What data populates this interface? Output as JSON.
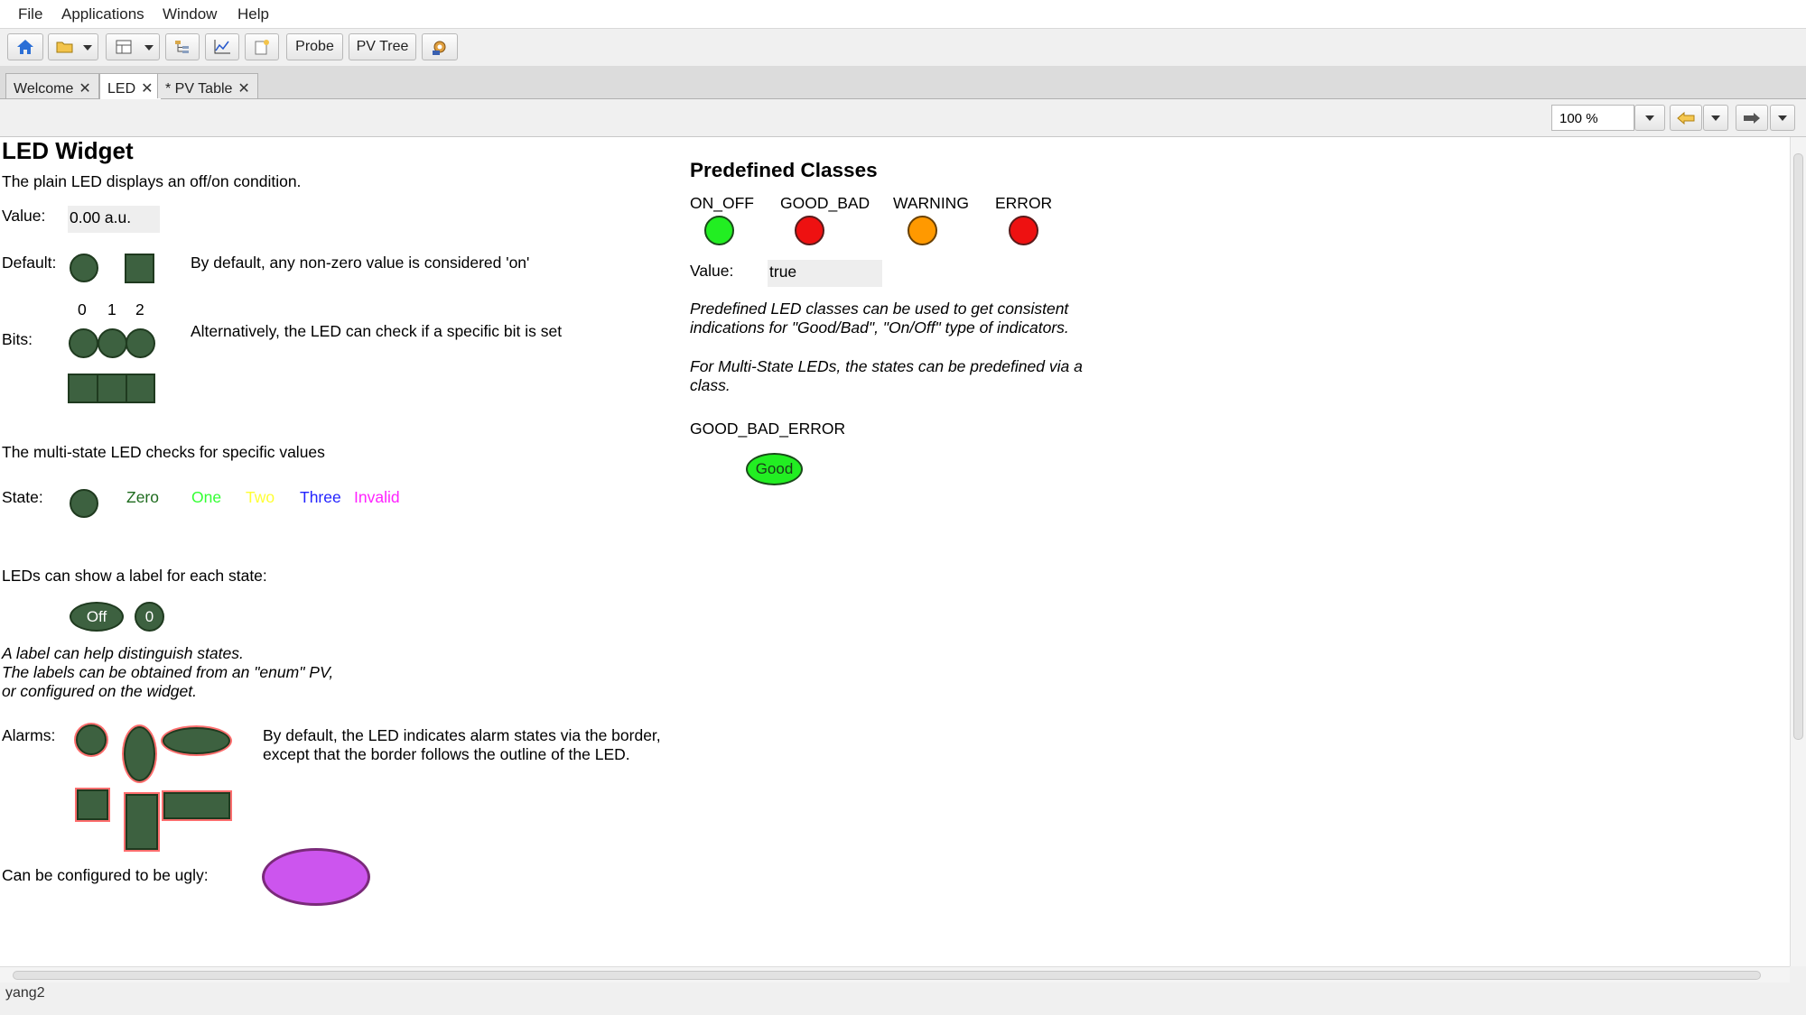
{
  "menu": [
    "File",
    "Applications",
    "Window",
    "Help"
  ],
  "toolbar": {
    "probe_label": "Probe",
    "pvtree_label": "PV Tree"
  },
  "tabs": [
    {
      "label": "Welcome",
      "close": "✕"
    },
    {
      "label": "LED",
      "close": "✕"
    },
    {
      "label": "* PV Table",
      "close": "✕"
    }
  ],
  "display_toolbar": {
    "zoom": "100 %"
  },
  "left": {
    "title": "LED Widget",
    "intro": "The plain LED displays an off/on condition.",
    "value_label": "Value:",
    "value_field": "0.00 a.u.",
    "default_label": "Default:",
    "default_desc": "By default, any non-zero value is considered 'on'",
    "bits_label": "Bits:",
    "bit_numbers": [
      "0",
      "1",
      "2"
    ],
    "bits_desc": "Alternatively, the LED can check if a specific bit is set",
    "multistate_desc": "The multi-state LED checks for specific values",
    "state_label": "State:",
    "states": [
      {
        "text": "Zero",
        "color": "#1e6b1e"
      },
      {
        "text": "One",
        "color": "#33ff33"
      },
      {
        "text": "Two",
        "color": "#ffff33"
      },
      {
        "text": "Three",
        "color": "#2222ff"
      },
      {
        "text": "Invalid",
        "color": "#ff22ff"
      }
    ],
    "labels_desc": "LEDs can show a label for each state:",
    "led_off_label": "Off",
    "led_zero_label": "0",
    "italic_lines": [
      "A label can help distinguish states.",
      "The labels can be obtained from an \"enum\" PV,",
      "or configured on the widget."
    ],
    "alarms_label": "Alarms:",
    "alarms_desc": [
      "By default, the LED indicates alarm states via the border,",
      "except that the border follows the outline of the LED."
    ],
    "ugly_label": "Can be configured to be ugly:"
  },
  "right": {
    "title": "Predefined Classes",
    "classes": [
      {
        "name": "ON_OFF",
        "color": "#22ee22"
      },
      {
        "name": "GOOD_BAD",
        "color": "#ee1111"
      },
      {
        "name": "WARNING",
        "color": "#ff9900"
      },
      {
        "name": "ERROR",
        "color": "#ee1111"
      }
    ],
    "value_label": "Value:",
    "value_field": "true",
    "italic1": [
      "Predefined LED classes can be used to get consistent",
      "indications for \"Good/Bad\", \"On/Off\" type of indicators."
    ],
    "italic2": [
      "For Multi-State LEDs, the states can be predefined via a",
      "class."
    ],
    "gbe_label": "GOOD_BAD_ERROR",
    "gbe_led_label": "Good"
  },
  "status": {
    "text": "yang2"
  },
  "colors": {
    "led_off": "#3d6140",
    "alarm_border": "#ff6e6e",
    "ugly": "#cc55ee"
  }
}
